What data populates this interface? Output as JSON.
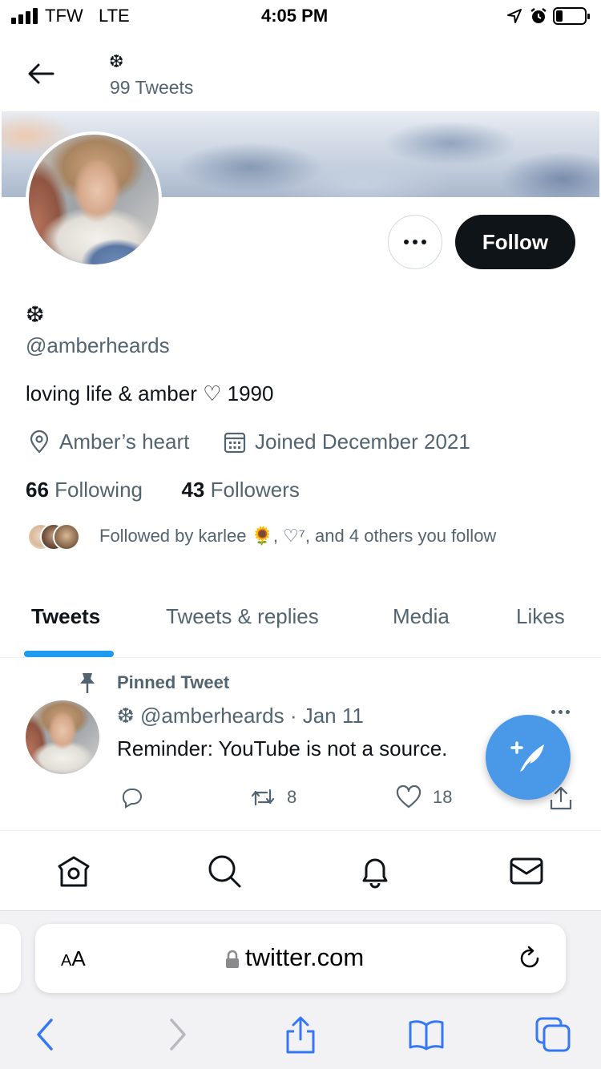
{
  "status_bar": {
    "carrier": "TFW",
    "network": "LTE",
    "time": "4:05 PM"
  },
  "header": {
    "name": "❆",
    "tweet_count": "99 Tweets"
  },
  "profile": {
    "display_name": "❆",
    "handle": "@amberheards",
    "bio": "loving life & amber ♡ 1990",
    "location": "Amber’s heart",
    "joined": "Joined December 2021",
    "following_count": "66",
    "following_label": "Following",
    "followers_count": "43",
    "followers_label": "Followers",
    "followed_by": "Followed by karlee 🌻, ♡⁷, and 4 others you follow",
    "follow_label": "Follow"
  },
  "tabs": [
    {
      "label": "Tweets",
      "active": true
    },
    {
      "label": "Tweets & replies",
      "active": false
    },
    {
      "label": "Media",
      "active": false
    },
    {
      "label": "Likes",
      "active": false
    }
  ],
  "pinned_tweet": {
    "pinned_label": "Pinned Tweet",
    "author_meta": "❆ @amberheards · Jan 11",
    "text": "Reminder: YouTube is not a source.",
    "replies": "",
    "retweets": "8",
    "likes": "18"
  },
  "browser": {
    "text_size_label_small": "A",
    "text_size_label_large": "A",
    "url": "twitter.com"
  },
  "colors": {
    "accent": "#1d9bf0",
    "fab": "#4a99e9",
    "safari_blue": "#3478f6",
    "text_primary": "#0f1419",
    "text_secondary": "#536471"
  }
}
